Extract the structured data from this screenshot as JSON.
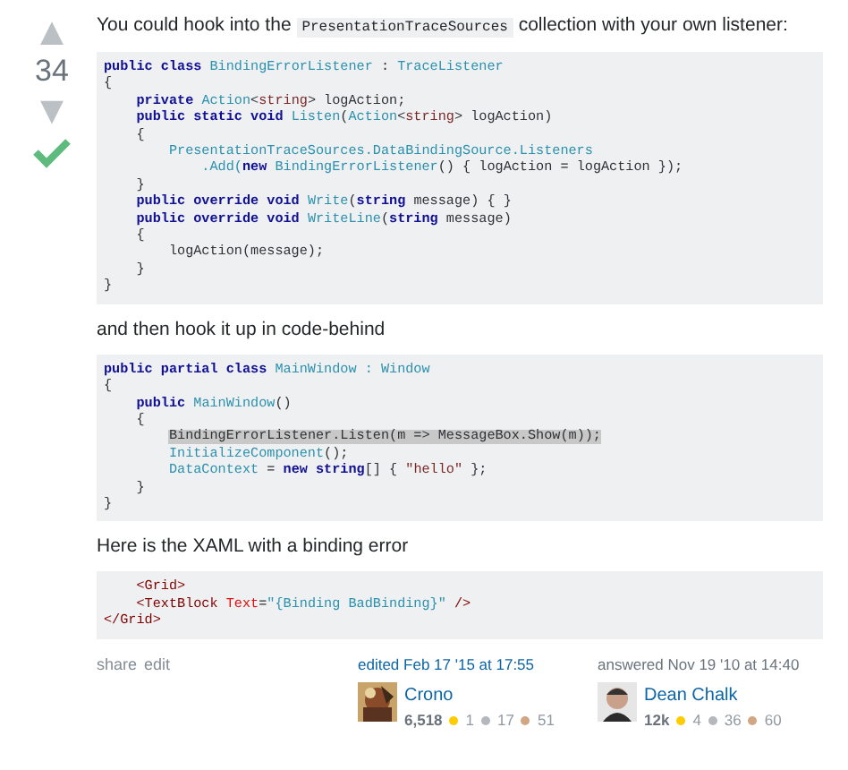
{
  "vote": {
    "up": "▲",
    "count": "34",
    "down": "▼",
    "accepted": true
  },
  "blocks": [
    {
      "kind": "para",
      "parts": [
        {
          "kind": "text",
          "t": "You could hook into the "
        },
        {
          "kind": "code",
          "t": "PresentationTraceSources"
        },
        {
          "kind": "text",
          "t": " collection with your own listener:"
        }
      ]
    },
    {
      "kind": "code",
      "lines": [
        [
          {
            "kind": "kw",
            "t": "public class "
          },
          {
            "kind": "type",
            "t": "BindingErrorListener"
          },
          {
            "kind": "pl",
            "t": " : "
          },
          {
            "kind": "type",
            "t": "TraceListener"
          }
        ],
        [
          {
            "kind": "pl",
            "t": "{"
          }
        ],
        [
          {
            "kind": "kw",
            "t": "    private "
          },
          {
            "kind": "type",
            "t": "Action"
          },
          {
            "kind": "pl",
            "t": "<"
          },
          {
            "kind": "str",
            "t": "string"
          },
          {
            "kind": "pl",
            "t": "> logAction;"
          }
        ],
        [
          {
            "kind": "kw",
            "t": "    public static void "
          },
          {
            "kind": "type",
            "t": "Listen"
          },
          {
            "kind": "pl",
            "t": "("
          },
          {
            "kind": "type",
            "t": "Action"
          },
          {
            "kind": "pl",
            "t": "<"
          },
          {
            "kind": "str",
            "t": "string"
          },
          {
            "kind": "pl",
            "t": "> logAction)"
          }
        ],
        [
          {
            "kind": "pl",
            "t": "    {"
          }
        ],
        [
          {
            "kind": "type",
            "t": "        PresentationTraceSources.DataBindingSource.Listeners"
          }
        ],
        [
          {
            "kind": "type",
            "t": "            .Add("
          },
          {
            "kind": "kw",
            "t": "new "
          },
          {
            "kind": "type",
            "t": "BindingErrorListener"
          },
          {
            "kind": "pl",
            "t": "() { logAction = logAction });"
          }
        ],
        [
          {
            "kind": "pl",
            "t": "    }"
          }
        ],
        [
          {
            "kind": "kw",
            "t": "    public override void "
          },
          {
            "kind": "type",
            "t": "Write"
          },
          {
            "kind": "pl",
            "t": "("
          },
          {
            "kind": "kw",
            "t": "string"
          },
          {
            "kind": "pl",
            "t": " message) { }"
          }
        ],
        [
          {
            "kind": "kw",
            "t": "    public override void "
          },
          {
            "kind": "type",
            "t": "WriteLine"
          },
          {
            "kind": "pl",
            "t": "("
          },
          {
            "kind": "kw",
            "t": "string"
          },
          {
            "kind": "pl",
            "t": " message)"
          }
        ],
        [
          {
            "kind": "pl",
            "t": "    {"
          }
        ],
        [
          {
            "kind": "pl",
            "t": "        logAction(message);"
          }
        ],
        [
          {
            "kind": "pl",
            "t": "    }"
          }
        ],
        [
          {
            "kind": "pl",
            "t": "}"
          }
        ]
      ]
    },
    {
      "kind": "para",
      "parts": [
        {
          "kind": "text",
          "t": "and then hook it up in code-behind"
        }
      ]
    },
    {
      "kind": "code",
      "lines": [
        [
          {
            "kind": "kw",
            "t": "public partial class "
          },
          {
            "kind": "type",
            "t": "MainWindow"
          },
          {
            "kind": "type",
            "t": " : "
          },
          {
            "kind": "type",
            "t": "Window"
          }
        ],
        [
          {
            "kind": "pl",
            "t": "{"
          }
        ],
        [
          {
            "kind": "kw",
            "t": "    public "
          },
          {
            "kind": "type",
            "t": "MainWindow"
          },
          {
            "kind": "pl",
            "t": "()"
          }
        ],
        [
          {
            "kind": "pl",
            "t": "    {"
          }
        ],
        [
          {
            "kind": "hl",
            "t": "        BindingErrorListener.Listen(m => MessageBox.Show(m));"
          }
        ],
        [
          {
            "kind": "type",
            "t": "        InitializeComponent"
          },
          {
            "kind": "pl",
            "t": "();"
          }
        ],
        [
          {
            "kind": "type",
            "t": "        DataContext"
          },
          {
            "kind": "pl",
            "t": " = "
          },
          {
            "kind": "kw",
            "t": "new string"
          },
          {
            "kind": "pl",
            "t": "[] { "
          },
          {
            "kind": "str",
            "t": "\"hello\""
          },
          {
            "kind": "pl",
            "t": " };"
          }
        ],
        [
          {
            "kind": "pl",
            "t": "    }"
          }
        ],
        [
          {
            "kind": "pl",
            "t": "}"
          }
        ]
      ]
    },
    {
      "kind": "para",
      "parts": [
        {
          "kind": "text",
          "t": "Here is the XAML with a binding error"
        }
      ]
    },
    {
      "kind": "code",
      "lines": [
        [
          {
            "kind": "tag",
            "t": "    <Grid>"
          }
        ],
        [
          {
            "kind": "tag",
            "t": "    <TextBlock "
          },
          {
            "kind": "attr",
            "t": "Text"
          },
          {
            "kind": "pl",
            "t": "="
          },
          {
            "kind": "type",
            "t": "\"{Binding BadBinding}\""
          },
          {
            "kind": "tag",
            "t": " />"
          }
        ],
        [
          {
            "kind": "tag",
            "t": "</Grid>"
          }
        ]
      ]
    }
  ],
  "links": [
    "share",
    "edit"
  ],
  "signatures": [
    {
      "action": "edited Feb 17 '15 at 17:55",
      "user": "Crono",
      "rep": "6,518",
      "badges": [
        {
          "count": "1",
          "color": "#ffcc01"
        },
        {
          "count": "17",
          "color": "#b4b8bc"
        },
        {
          "count": "51",
          "color": "#d1a684"
        }
      ]
    },
    {
      "action": "answered Nov 19 '10 at 14:40",
      "user": "Dean Chalk",
      "rep": "12k",
      "badges": [
        {
          "count": "4",
          "color": "#ffcc01"
        },
        {
          "count": "36",
          "color": "#b4b8bc"
        },
        {
          "count": "60",
          "color": "#d1a684"
        }
      ]
    }
  ]
}
